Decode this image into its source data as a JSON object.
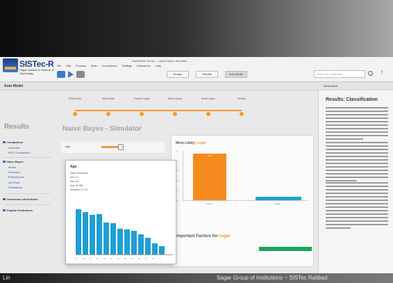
{
  "app": {
    "logo_title": "SISTec-R",
    "logo_subtitle": "Sagar Institute of Science & Technology",
    "window_title": "RapidMiner Studio — Naive Bayes Simulator",
    "menu": [
      "File",
      "Edit",
      "Process",
      "View",
      "Connections",
      "Settings",
      "Extensions",
      "Help"
    ],
    "view_buttons": [
      "Design",
      "Results",
      "Auto Model"
    ],
    "search_placeholder": "Search for Operators",
    "model_label": "Auto Model",
    "info_tab": "Information"
  },
  "steps": [
    "Select Data",
    "Select Task",
    "Prepare Target",
    "Select Inputs",
    "Model Types",
    "Results"
  ],
  "nav": {
    "title": "Results",
    "items": [
      {
        "label": "Comparison",
        "head": true
      },
      {
        "label": "Overview",
        "head": false
      },
      {
        "label": "ROC Comparison",
        "head": false
      },
      {
        "label": "Naive Bayes",
        "head": true
      },
      {
        "label": "Model",
        "head": false
      },
      {
        "label": "Simulator",
        "head": false
      },
      {
        "label": "Performance",
        "head": false
      },
      {
        "label": "Lift Chart",
        "head": false
      },
      {
        "label": "Predictions",
        "head": false
      },
      {
        "label": "Download Latest Model",
        "head": true
      },
      {
        "label": "Explain Predictions",
        "head": true
      }
    ]
  },
  "page_title": "Naive Bayes - Simulator",
  "simulator": {
    "age_label": "Age"
  },
  "likely": {
    "title_prefix": "Most Likely:",
    "title_value": "Legal",
    "important_prefix": "Important Factors for",
    "important_value": "Legal"
  },
  "chart_data": {
    "type": "bar",
    "categories": [
      "Legal",
      "Illegal"
    ],
    "values": [
      0.93,
      0.07
    ],
    "bar_labels": [
      "0.93",
      ""
    ],
    "ylim": [
      0,
      1
    ],
    "yticks": [
      "1.0",
      "0.8",
      "0.6",
      "0.4",
      "0.2",
      "0.0"
    ],
    "colors": [
      "#f68a1e",
      "#1f9fd3"
    ]
  },
  "popup": {
    "title": "Age",
    "lines": [
      "Type: Numerical",
      "Min: 17",
      "Max: 81",
      "Avg: 40.083",
      "Deviation: 9.775"
    ],
    "histogram": [
      0.95,
      0.9,
      0.84,
      0.86,
      0.68,
      0.66,
      0.55,
      0.53,
      0.5,
      0.42,
      0.35,
      0.24,
      0.18
    ],
    "ticks": [
      "17",
      "22",
      "27",
      "32",
      "37",
      "42",
      "47",
      "52",
      "57",
      "62",
      "67",
      "72",
      "77"
    ],
    "bar_color": "#1f9fd3"
  },
  "info_panel": {
    "title": "Results: Classification"
  },
  "overlay": {
    "bottom_left": "Lin",
    "bottom_right": "Sagar Group of Institutions  ~  SISTec Ratibad"
  }
}
